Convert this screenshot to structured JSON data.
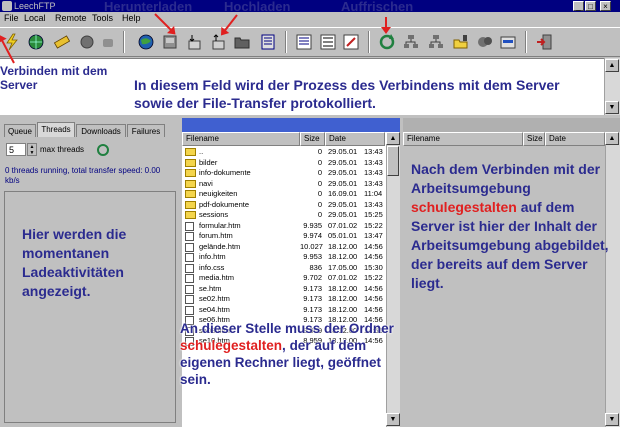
{
  "window": {
    "title": "LeechFTP"
  },
  "menu": [
    "File",
    "Local",
    "Remote",
    "Tools",
    "Help"
  ],
  "top_labels": {
    "download": "Herunterladen",
    "upload": "Hochladen",
    "refresh": "Auffrischen"
  },
  "annotations": {
    "connect": "Verbinden mit dem Server",
    "log": "In diesem Feld wird  der Prozess des Verbindens mit dem Server sowie der File-Transfer protokolliert.",
    "activity": "Hier werden die momentanen Ladeaktivitäten angezeigt.",
    "remote_1": "Nach dem Verbinden mit der Arbeitsumgebung",
    "remote_red": "schulegestalten",
    "remote_2": "auf dem Server ist hier der Inhalt der Arbeitsumgebung abgebildet, der bereits auf dem Server liegt.",
    "local_1": "An dieser Stelle muss der Ordner",
    "local_red": "schulegestalten",
    "local_2": "der auf dem eigenen Rechner liegt, geöffnet sein."
  },
  "left_panel": {
    "tabs": [
      "Queue",
      "Threads",
      "Downloads",
      "Failures"
    ],
    "threads_value": "5",
    "threads_label": "max threads",
    "info": "0 threads running, total transfer speed: 0.00 kb/s"
  },
  "local_panel": {
    "columns": [
      "Filename",
      "Size",
      "Date"
    ],
    "rows": [
      {
        "name": "..",
        "size": "0",
        "date": "29.05.01",
        "time": "13:43",
        "type": "folder"
      },
      {
        "name": "bilder",
        "size": "0",
        "date": "29.05.01",
        "time": "13:43",
        "type": "folder"
      },
      {
        "name": "info-dokumente",
        "size": "0",
        "date": "29.05.01",
        "time": "13:43",
        "type": "folder"
      },
      {
        "name": "navi",
        "size": "0",
        "date": "29.05.01",
        "time": "13:43",
        "type": "folder"
      },
      {
        "name": "neuigkeiten",
        "size": "0",
        "date": "16.09.01",
        "time": "11:04",
        "type": "folder"
      },
      {
        "name": "pdf-dokumente",
        "size": "0",
        "date": "29.05.01",
        "time": "13:43",
        "type": "folder"
      },
      {
        "name": "sessions",
        "size": "0",
        "date": "29.05.01",
        "time": "15:25",
        "type": "folder"
      },
      {
        "name": "formular.htm",
        "size": "9.935",
        "date": "07.01.02",
        "time": "15:22",
        "type": "file"
      },
      {
        "name": "forum.htm",
        "size": "9.974",
        "date": "05.01.01",
        "time": "13:47",
        "type": "file"
      },
      {
        "name": "gelände.htm",
        "size": "10.027",
        "date": "18.12.00",
        "time": "14:56",
        "type": "file"
      },
      {
        "name": "info.htm",
        "size": "9.953",
        "date": "18.12.00",
        "time": "14:56",
        "type": "file"
      },
      {
        "name": "info.css",
        "size": "836",
        "date": "17.05.00",
        "time": "15:30",
        "type": "file"
      },
      {
        "name": "media.htm",
        "size": "9.702",
        "date": "07.01.02",
        "time": "15:22",
        "type": "file"
      },
      {
        "name": "se.htm",
        "size": "9.173",
        "date": "18.12.00",
        "time": "14:56",
        "type": "file"
      },
      {
        "name": "se02.htm",
        "size": "9.173",
        "date": "18.12.00",
        "time": "14:56",
        "type": "file"
      },
      {
        "name": "se04.htm",
        "size": "9.173",
        "date": "18.12.00",
        "time": "14:56",
        "type": "file"
      },
      {
        "name": "se06.htm",
        "size": "9.173",
        "date": "18.12.00",
        "time": "14:56",
        "type": "file"
      },
      {
        "name": "se08.htm",
        "size": "8.959",
        "date": "18.12.00",
        "time": "14:56",
        "type": "file"
      },
      {
        "name": "se10.htm",
        "size": "8.959",
        "date": "18.12.00",
        "time": "14:56",
        "type": "file"
      }
    ]
  },
  "remote_panel": {
    "columns": [
      "Filename",
      "Size",
      "Date"
    ]
  }
}
